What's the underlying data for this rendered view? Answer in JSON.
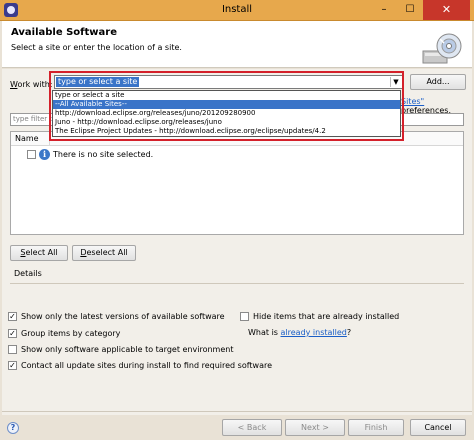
{
  "window": {
    "title": "Install",
    "minimize_glyph": "–",
    "maximize_glyph": "☐",
    "close_glyph": "✕"
  },
  "header": {
    "title": "Available Software",
    "subtitle": "Select a site or enter the location of a site."
  },
  "work_with": {
    "label_prefix": "W",
    "label_rest": "ork with:",
    "selected_value": "type or select a site",
    "add_button": "Add...",
    "dropdown_items": [
      "type or select a site",
      "--All Available Sites--",
      "http://download.eclipse.org/releases/juno/201209280900",
      "Juno - http://download.eclipse.org/releases/juno",
      "The Eclipse Project Updates - http://download.eclipse.org/eclipse/updates/4.2"
    ],
    "selected_index": 1
  },
  "preferences": {
    "link": "Sites\"",
    "text": " preferences."
  },
  "filter": {
    "placeholder": "type filter te"
  },
  "tree": {
    "column_name": "Name",
    "empty_message": "There is no site selected."
  },
  "buttons": {
    "select_all_mnemonic": "S",
    "select_all_rest": "elect All",
    "deselect_all_mnemonic": "D",
    "deselect_all_rest": "eselect All",
    "back": "< Back",
    "next": "Next >",
    "finish": "Finish",
    "cancel": "Cancel"
  },
  "details": {
    "label": "Details"
  },
  "options": {
    "show_latest": "Show only the latest versions of available software",
    "group_by_category": "Group items by category",
    "show_applicable": "Show only software applicable to target environment",
    "contact_sites": "Contact all update sites during install to find required software",
    "hide_installed": "Hide items that are already installed",
    "what_is_prefix": "What is ",
    "what_is_link": "already installed",
    "what_is_suffix": "?",
    "checks": {
      "show_latest": true,
      "group_by_category": true,
      "show_applicable": false,
      "contact_sites": true,
      "hide_installed": false
    }
  },
  "colors": {
    "title_bar": "#e7a84c",
    "close_button": "#c7362a",
    "selection": "#3a74c8",
    "highlight_box": "#d4202a",
    "link": "#1a5ec7"
  },
  "icons": {
    "app": "eclipse-icon",
    "banner": "install-cd-icon",
    "info": "info-icon",
    "help": "help-icon",
    "dropdown": "chevron-down-icon"
  }
}
